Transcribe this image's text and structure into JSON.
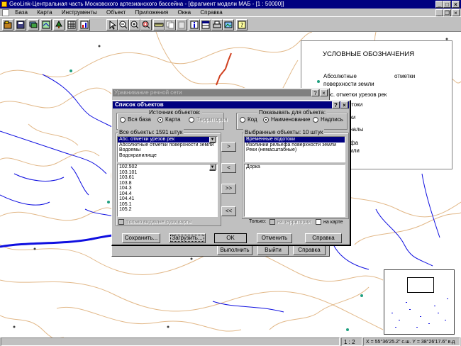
{
  "app": {
    "title": "GeoLink-Центральная часть Московского артезианского бассейна - [фрагмент модели МАБ - [1 : 50000]]"
  },
  "menu": [
    "База",
    "Карта",
    "Инструменты",
    "Объект",
    "Приложения",
    "Окна",
    "Справка"
  ],
  "toolbar": {
    "icons": [
      "db-open-icon",
      "db-save-icon",
      "layers-icon",
      "map-icon",
      "tree-icon",
      "grid-icon",
      "chart-icon",
      "pointer-icon",
      "zoom-out-icon",
      "zoom-in-icon",
      "zoom-window-icon",
      "ruler-icon",
      "copy-icon",
      "paste-icon",
      "info-icon",
      "table-icon",
      "print-icon",
      "image-icon",
      "help-icon"
    ]
  },
  "legend": {
    "title": "УСЛОВНЫЕ ОБОЗНАЧЕНИЯ",
    "items": [
      {
        "line1": "Абсолютные",
        "line1b": "отметки",
        "line2": "поверхности земли"
      },
      {
        "line1": "Абс. отметки урезов рек"
      },
      {
        "line1": "ные водотоки"
      },
      {
        "line1": "Реки"
      },
      {
        "line1": "Каналы"
      },
      {
        "line1": "ии рельефа",
        "line2": "ности земли"
      }
    ]
  },
  "bg_dialog": {
    "title": "Уравнивание речной сети",
    "buttons": {
      "run": "Выполнить",
      "exit": "Выйти",
      "help": "Справка"
    }
  },
  "dialog": {
    "title": "Список объектов",
    "source_group": "Источник объектов:",
    "source_options": [
      "Вся база",
      "Карта",
      "Территория"
    ],
    "show_group": "Показывать для объекта:",
    "show_options": [
      "Код",
      "Наименование",
      "Надпись"
    ],
    "all_objects_label": "Все объекты: 1591 штук",
    "selected_objects_label": "Выбранные объекты: 10 штук",
    "all_types": [
      "Абс. отметки урезов рек",
      "Абсолютные отметки поверхности земли",
      "Водоемы",
      "Водохранилище"
    ],
    "all_values": [
      "102.502",
      "103.101",
      "103.61",
      "103.8",
      "104.3",
      "104.4",
      "104.41",
      "105.1",
      "105.2"
    ],
    "selected_types": [
      "Временные водотоки",
      "Изолинии рельефа поверхности земли",
      "Реки (немасштабные)"
    ],
    "selected_values": [
      "Дорка"
    ],
    "move_buttons": [
      ">",
      "<",
      ">>",
      "<<"
    ],
    "only_visible": "Только видимые суом карты",
    "only_label": "Только:",
    "terrain_check": "на территории",
    "map_check": "на карте",
    "buttons": {
      "save": "Сохранить...",
      "load": "Загрузить...",
      "ok": "OK",
      "cancel": "Отменить",
      "help": "Справка"
    }
  },
  "status": {
    "scale": "1 : 2",
    "coords": "X = 55°36'25.2\" с.ш. Y = 38°26'17.6\" в.д"
  },
  "colors": {
    "title": "#000080",
    "river": "#1010e0",
    "road": "#d04020",
    "contour": "#e2b888"
  }
}
